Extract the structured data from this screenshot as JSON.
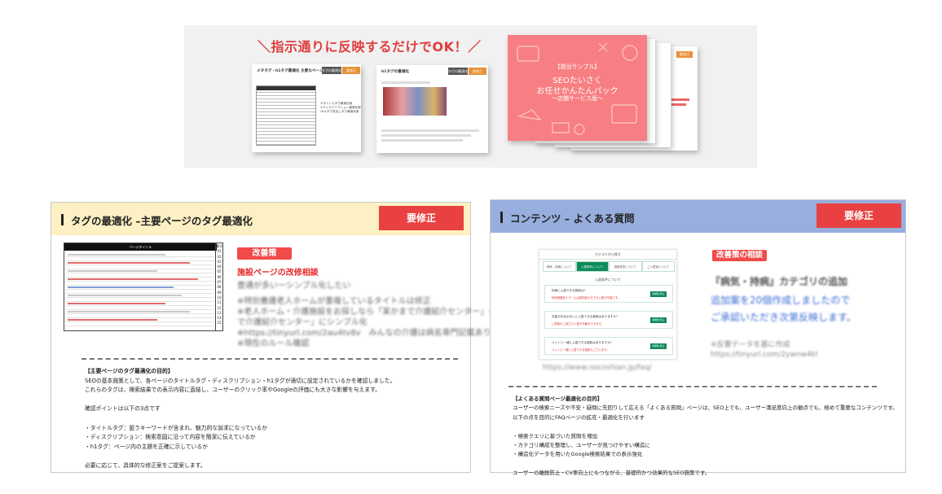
{
  "banner": {
    "title": "＼指示通りに反映するだけでOK！／",
    "thumb1": {
      "title": "メタタグ・h1タグ最適化 主要なページ",
      "btn_dark": "タグの最適化",
      "btn_orange": "要修正",
      "lines": [
        "①タイトルタグ最適化案",
        "②ディスクリプション最適化案",
        "③h1タグ見出しタグ最適化案"
      ]
    },
    "thumb2": {
      "title": "h1タグの最適化",
      "btn_dark": "タグの最適化",
      "btn_orange": "要修正"
    },
    "cover": {
      "label_small": "【提出サンプル】",
      "line1": "SEOたいさく",
      "line2": "お任せかんたんパック",
      "line3": "〜店舗サービス版〜"
    },
    "back_badge": "要修正"
  },
  "panel_left": {
    "title": "タグの最適化 –主要ページのタグ最適化",
    "fix_label": "要修正",
    "table_header": "ページタイトル",
    "row_nums": [
      "番号",
      "01",
      "02",
      "03",
      "04",
      "05",
      "06",
      "07",
      "08",
      "09",
      "10",
      "11",
      "12",
      "13",
      "14",
      "15"
    ],
    "tag": "改善策",
    "subtitle": "施設ページの改修相談",
    "blur_lines": [
      "豊通が多いーシンプル化したい",
      "",
      "※特別養護老人ホームが重複しているタイトルは修正",
      "※老人ホーム・介護施設をお探しなら「某かまで介護紹介センター」→「某かま",
      "で介護紹介センター」にシンプル化",
      "※https://tinyurl.com/2au4tv8v　みんなの介護は病名専門記載あり",
      "※現在のルール確認"
    ],
    "body": {
      "heading": "【主要ページのタグ最適化の目的】",
      "lines": [
        "SEOの基本施策として、各ページのタイトルタグ・ディスクリプション・h1タグが適切に設定されているかを確認しました。",
        "これらのタグは、検索結果での表示内容に直結し、ユーザーのクリック率やGoogleの評価にも大きな影響を与えます。",
        "",
        "確認ポイントは以下の3点です",
        "",
        "・タイトルタグ：狙うキーワードが含まれ、魅力的な訴求になっているか",
        "・ディスクリプション：検索意図に沿って内容を簡潔に伝えているか",
        "・h1タグ：ページ内の主題を正確に示しているか",
        "",
        "必要に応じて、具体的な修正案をご提案します。"
      ]
    }
  },
  "panel_right": {
    "title": "コンテンツ – よくある質問",
    "fix_label": "要修正",
    "faq": {
      "top": "カテゴリから探す",
      "tabs": [
        "病気・持病について",
        "入居条件について",
        "施設見学について",
        "ご入居後について"
      ],
      "active_tab": 1,
      "sub": "入居条件について",
      "items": [
        {
          "q": "持病に入居できる施設は？",
          "a": "特別養護老人ホームは認知症の方でも入居が可能です。",
          "b": "詳細を見る"
        },
        {
          "q": "お給与を払わないと入居できる施設はありますか？",
          "a": "ご家族のご協力で入居がお勧めできます。",
          "b": "詳細を見る"
        },
        {
          "q": "ペットと一緒に入居できる施設はありますか？",
          "a": "ペットと一緒に入居できる施設もございます。",
          "b": "詳細を見る"
        }
      ]
    },
    "faq_url": "https://www.nocoshian.jp/faq/",
    "tag": "改善策の相談",
    "proposal_title": "『病気・持病』カテゴリの追加",
    "proposal_blue1": "追加案を20個作成しましたので",
    "proposal_blue2": "ご承認いただき次第反映します。",
    "proposal_note1": "※反響データを基に作成",
    "proposal_note2": "https://tinyurl.com/2ywnw4kl",
    "body": {
      "heading": "【よくある質問ページ最適化の目的】",
      "lines": [
        "ユーザーの検索ニーズや不安・疑問に先回りして応える「よくある質問」ページは、SEO上でも、ユーザー満足度向上の観点でも、極めて重要なコンテンツです。",
        "以下の点を目的にFAQページの拡充・最適化を行います",
        "",
        "・検索クエリに基づいた質問を増加",
        "・カテゴリ構成を整理し、ユーザーが見つけやすい構造に",
        "・構造化データを用いたGoogle検索結果での表示強化",
        "",
        "ユーザーの離脱防止・CV率向上にもつながる、基礎的かつ効果的なSEO施策です。"
      ]
    }
  },
  "colors": {
    "accent_red": "#e94141",
    "left_header_bg": "#fdf0c4",
    "right_header_bg": "#97aede",
    "faq_green": "#0d8a5a"
  }
}
